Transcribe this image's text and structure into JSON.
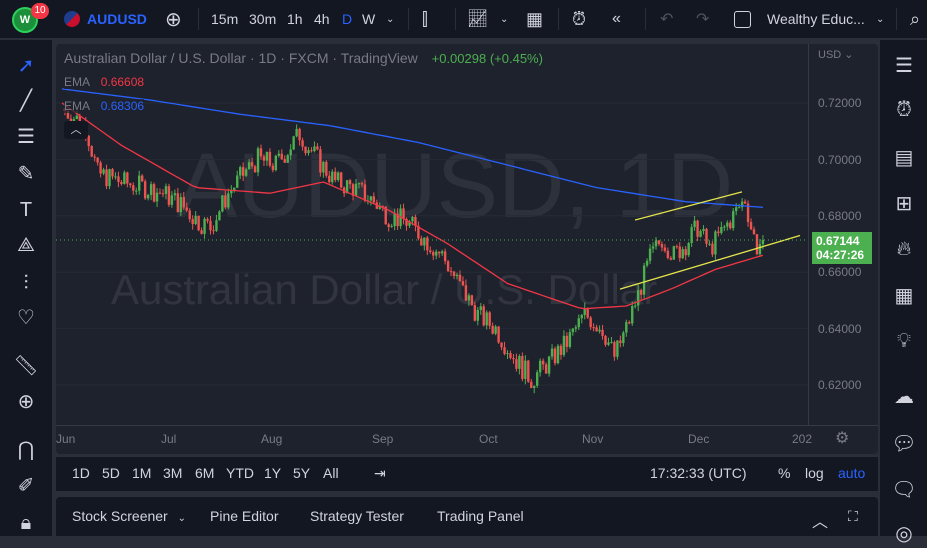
{
  "topbar": {
    "notif_count": "10",
    "symbol": "AUDUSD",
    "intervals": [
      "15m",
      "30m",
      "1h",
      "4h",
      "D",
      "W"
    ],
    "active_interval": "D",
    "layout_name": "Wealthy Educ..."
  },
  "legend": {
    "title": "Australian Dollar / U.S. Dollar · 1D · FXCM · TradingView",
    "change": "+0.00298 (+0.45%)",
    "ema1_label": "EMA",
    "ema1_value": "0.66608",
    "ema2_label": "EMA",
    "ema2_value": "0.68306"
  },
  "watermark": {
    "line1": "AUDUSD, 1D",
    "line2": "Australian Dollar / U.S. Dollar"
  },
  "price_axis": {
    "currency": "USD",
    "labels": [
      "0.72000",
      "0.70000",
      "0.68000",
      "0.66000",
      "0.64000",
      "0.62000"
    ],
    "last_price": "0.67144",
    "countdown": "04:27:26"
  },
  "time_axis": {
    "labels": [
      "Jun",
      "Jul",
      "Aug",
      "Sep",
      "Oct",
      "Nov",
      "Dec",
      "202"
    ]
  },
  "rangebar": {
    "ranges": [
      "1D",
      "5D",
      "1M",
      "3M",
      "6M",
      "YTD",
      "1Y",
      "5Y",
      "All"
    ],
    "clock": "17:32:33 (UTC)",
    "percent": "%",
    "log": "log",
    "auto": "auto"
  },
  "bottompanel": {
    "tabs": [
      "Stock Screener",
      "Pine Editor",
      "Strategy Tester",
      "Trading Panel"
    ]
  },
  "colors": {
    "up": "#26a69a",
    "up_candle": "#4caf50",
    "down": "#ef5350",
    "ema_fast": "#f23645",
    "ema_slow": "#2962ff",
    "channel": "#e5e54a",
    "accent": "#2962ff"
  },
  "chart_data": {
    "type": "candlestick",
    "title": "AUDUSD 1D",
    "ylim": [
      0.61,
      0.735
    ],
    "close_path": [
      [
        0,
        0.718
      ],
      [
        8,
        0.712
      ],
      [
        12,
        0.695
      ],
      [
        20,
        0.692
      ],
      [
        28,
        0.69
      ],
      [
        34,
        0.688
      ],
      [
        40,
        0.684
      ],
      [
        46,
        0.678
      ],
      [
        50,
        0.676
      ],
      [
        56,
        0.688
      ],
      [
        62,
        0.696
      ],
      [
        66,
        0.7
      ],
      [
        72,
        0.698
      ],
      [
        80,
        0.709
      ],
      [
        86,
        0.7
      ],
      [
        92,
        0.692
      ],
      [
        98,
        0.69
      ],
      [
        104,
        0.686
      ],
      [
        110,
        0.68
      ],
      [
        116,
        0.678
      ],
      [
        122,
        0.672
      ],
      [
        128,
        0.666
      ],
      [
        134,
        0.655
      ],
      [
        140,
        0.645
      ],
      [
        146,
        0.64
      ],
      [
        152,
        0.63
      ],
      [
        158,
        0.622
      ],
      [
        164,
        0.628
      ],
      [
        170,
        0.635
      ],
      [
        176,
        0.645
      ],
      [
        182,
        0.64
      ],
      [
        186,
        0.63
      ],
      [
        190,
        0.64
      ],
      [
        194,
        0.652
      ],
      [
        198,
        0.665
      ],
      [
        202,
        0.672
      ],
      [
        206,
        0.666
      ],
      [
        210,
        0.67
      ],
      [
        214,
        0.676
      ],
      [
        218,
        0.668
      ],
      [
        222,
        0.674
      ],
      [
        226,
        0.68
      ],
      [
        230,
        0.686
      ],
      [
        232,
        0.676
      ],
      [
        234,
        0.669
      ],
      [
        236,
        0.6714
      ]
    ],
    "ema_fast_path": [
      [
        0,
        0.72
      ],
      [
        20,
        0.705
      ],
      [
        45,
        0.69
      ],
      [
        70,
        0.688
      ],
      [
        88,
        0.692
      ],
      [
        110,
        0.682
      ],
      [
        130,
        0.67
      ],
      [
        150,
        0.656
      ],
      [
        175,
        0.647
      ],
      [
        190,
        0.648
      ],
      [
        205,
        0.654
      ],
      [
        220,
        0.661
      ],
      [
        236,
        0.666
      ]
    ],
    "ema_slow_path": [
      [
        0,
        0.725
      ],
      [
        30,
        0.721
      ],
      [
        60,
        0.716
      ],
      [
        90,
        0.712
      ],
      [
        120,
        0.706
      ],
      [
        150,
        0.698
      ],
      [
        180,
        0.69
      ],
      [
        210,
        0.685
      ],
      [
        236,
        0.683
      ]
    ],
    "channel_upper": [
      [
        0.6785,
        "Nov-15"
      ],
      [
        0.6885,
        "Dec-12"
      ]
    ],
    "channel_lower": [
      [
        0.654,
        "Nov-10"
      ],
      [
        0.673,
        "Dec-31"
      ]
    ],
    "last_price": 0.67144
  }
}
